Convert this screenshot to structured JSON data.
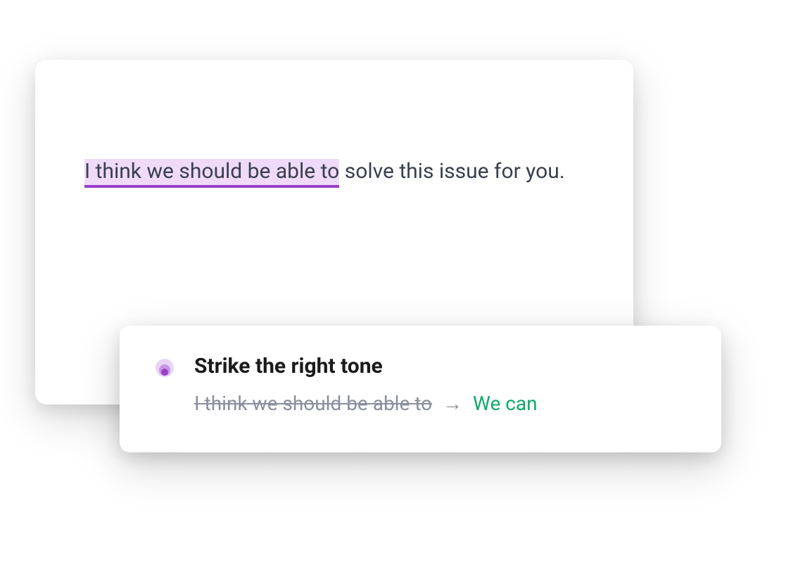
{
  "editor": {
    "highlighted_text": "I think we should be able to",
    "remaining_text": " solve this issue for you."
  },
  "suggestion": {
    "title": "Strike the right tone",
    "original": "I think we should be able to",
    "arrow": "→",
    "replacement": "We can",
    "icon_name": "tone-icon"
  },
  "colors": {
    "highlight_bg": "#efdaf9",
    "highlight_underline": "#9b3fc7",
    "text": "#3a3f4d",
    "strikethrough": "#8a8f9c",
    "replacement": "#0fa968"
  }
}
